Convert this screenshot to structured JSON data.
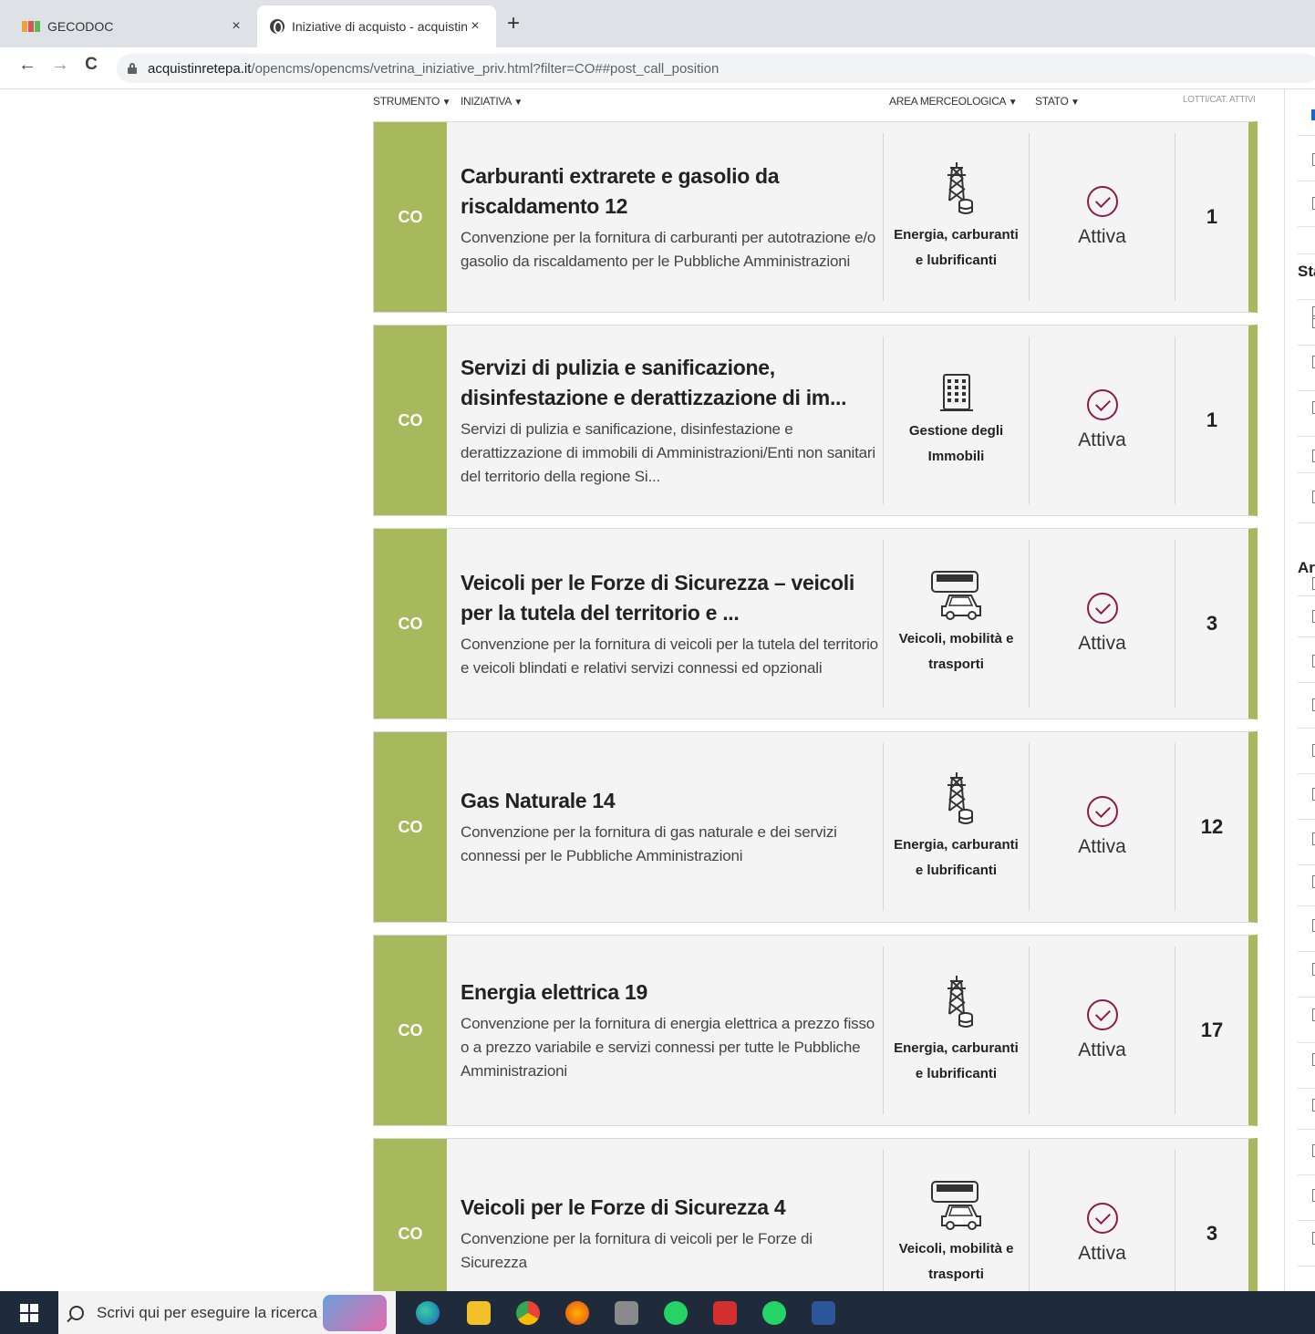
{
  "browser": {
    "tabs": [
      {
        "title": "GECODOC",
        "close": "×"
      },
      {
        "title": "Iniziative di acquisto - acquistinre",
        "close": "×"
      }
    ],
    "new_tab": "+",
    "nav": {
      "back": "←",
      "forward": "→",
      "reload": "C"
    },
    "url": {
      "domain": "acquistinretepa.it",
      "path": "/opencms/opencms/vetrina_iniziative_priv.html?filter=CO##post_call_position"
    }
  },
  "table": {
    "headers": {
      "strumento": "STRUMENTO",
      "iniziativa": "INIZIATIVA",
      "area": "AREA MERCEOLOGICA",
      "stato": "STATO",
      "lotti": "LOTTI/CAT. ATTIVI"
    },
    "rows": [
      {
        "strumento": "CO",
        "title": "Carburanti extrarete e gasolio da riscaldamento 12",
        "description": "Convenzione per la fornitura di carburanti per autotrazione e/o gasolio da riscaldamento per le Pubbliche Amministrazioni",
        "area_line1": "Energia, carburanti",
        "area_line2": "e lubrificanti",
        "area_icon": "energy-tower-icon",
        "stato": "Attiva",
        "lotti": "1"
      },
      {
        "strumento": "CO",
        "title": "Servizi di pulizia e sanificazione, disinfestazione e derattizzazione di im...",
        "description": "Servizi di pulizia e sanificazione, disinfestazione e derattizzazione di immobili di Amministrazioni/Enti non sanitari del territorio della regione Si...",
        "area_line1": "Gestione degli",
        "area_line2": "Immobili",
        "area_icon": "building-icon",
        "stato": "Attiva",
        "lotti": "1"
      },
      {
        "strumento": "CO",
        "title": "Veicoli per le Forze di Sicurezza – veicoli per la tutela del territorio e ...",
        "description": "Convenzione per la fornitura di veicoli per la tutela del territorio e veicoli blindati e relativi servizi connessi ed opzionali",
        "area_line1": "Veicoli, mobilità e",
        "area_line2": "trasporti",
        "area_icon": "vehicles-icon",
        "stato": "Attiva",
        "lotti": "3"
      },
      {
        "strumento": "CO",
        "title": "Gas Naturale 14",
        "description": "Convenzione per la fornitura di gas naturale e dei servizi connessi per le Pubbliche Amministrazioni",
        "area_line1": "Energia, carburanti",
        "area_line2": "e lubrificanti",
        "area_icon": "energy-tower-icon",
        "stato": "Attiva",
        "lotti": "12"
      },
      {
        "strumento": "CO",
        "title": "Energia elettrica 19",
        "description": "Convenzione per la fornitura di energia elettrica a prezzo fisso o a prezzo variabile e servizi connessi per tutte le Pubbliche Amministrazioni",
        "area_line1": "Energia, carburanti",
        "area_line2": "e lubrificanti",
        "area_icon": "energy-tower-icon",
        "stato": "Attiva",
        "lotti": "17"
      },
      {
        "strumento": "CO",
        "title": "Veicoli per le Forze di Sicurezza 4",
        "description": "Convenzione per la fornitura di veicoli per le Forze di Sicurezza",
        "area_line1": "Veicoli, mobilità e",
        "area_line2": "trasporti",
        "area_icon": "vehicles-icon",
        "stato": "Attiva",
        "lotti": "3"
      }
    ]
  },
  "sidebar": {
    "label_stato": "Sta",
    "label_area": "Are"
  },
  "taskbar": {
    "search_placeholder": "Scrivi qui per eseguire la ricerca"
  },
  "colors": {
    "accent_green": "#a7b85d",
    "status_purple": "#8e1a4a",
    "taskbar": "#1f2a3a"
  }
}
